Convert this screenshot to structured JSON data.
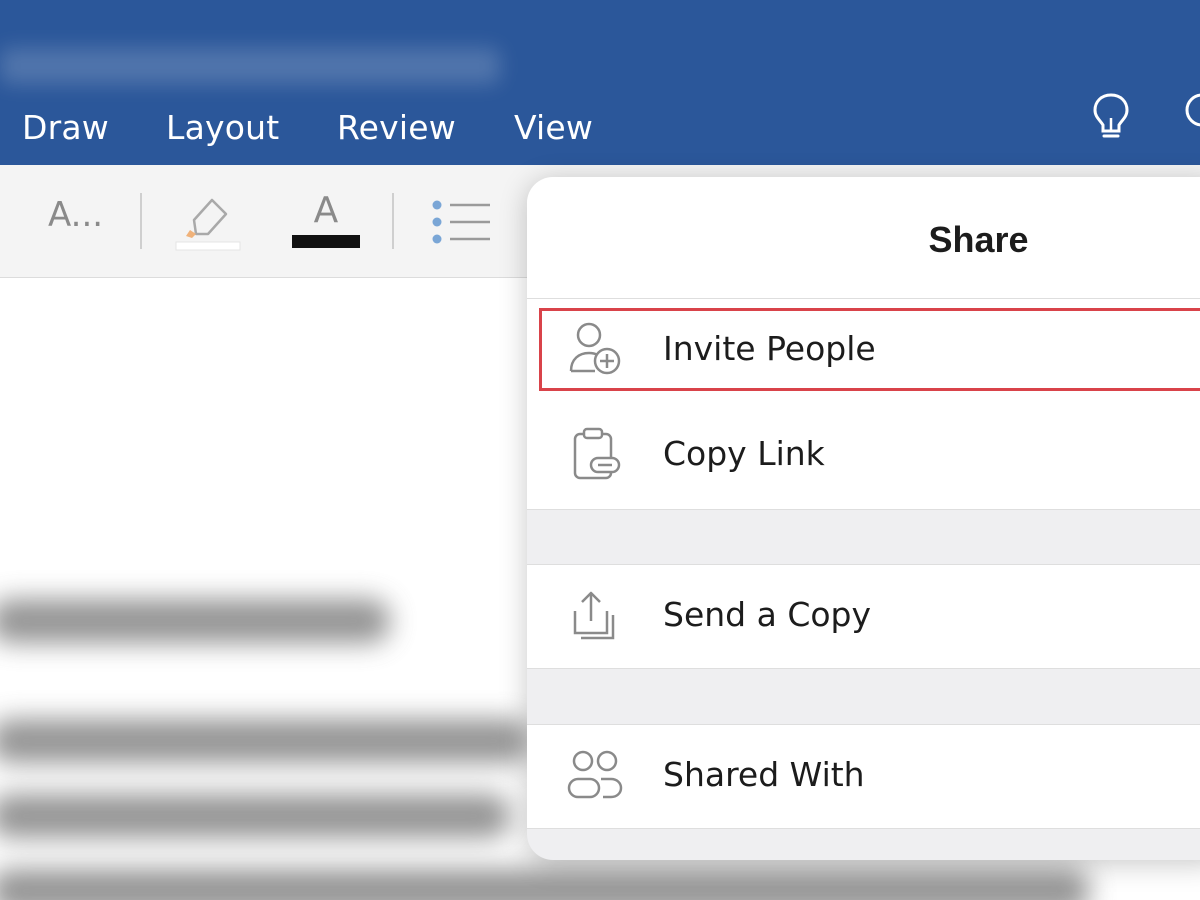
{
  "ribbon": {
    "tabs": [
      "Draw",
      "Layout",
      "Review",
      "View"
    ],
    "color": "#2b579a",
    "icons": [
      "lightbulb-icon",
      "search-icon"
    ]
  },
  "toolbar": {
    "font_style_label": "A...",
    "font_color_glyph": "A",
    "icons": [
      "font-style-icon",
      "highlighter-icon",
      "font-color-icon",
      "bullet-list-icon"
    ]
  },
  "share_panel": {
    "title": "Share",
    "items": [
      {
        "label": "Invite People",
        "icon": "add-person-icon",
        "highlighted": true
      },
      {
        "label": "Copy Link",
        "icon": "copy-link-icon"
      },
      {
        "label": "Send a Copy",
        "icon": "share-upload-icon"
      },
      {
        "label": "Shared With",
        "icon": "people-icon"
      }
    ],
    "highlight_color": "#d9434a"
  }
}
